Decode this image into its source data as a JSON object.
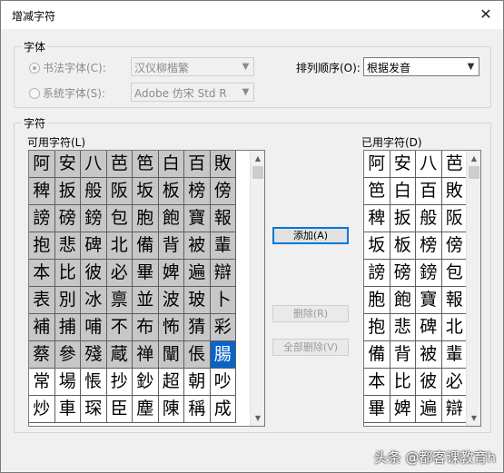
{
  "window": {
    "title": "增减字符",
    "close": "✕"
  },
  "font_group": {
    "label": "字体",
    "calligraphy_radio": "书法字体(C):",
    "calligraphy_value": "汉仪柳楷繁",
    "system_radio": "系统字体(S):",
    "system_value": "Adobe 仿宋 Std R",
    "sort_label": "排列顺序(O):",
    "sort_value": "根据发音"
  },
  "chars_group": {
    "label": "字符",
    "available_label": "可用字符(L)",
    "used_label": "已用字符(D)",
    "available": [
      [
        "阿",
        "安",
        "八",
        "芭",
        "笆",
        "白",
        "百",
        "敗"
      ],
      [
        "稗",
        "扳",
        "般",
        "阪",
        "坂",
        "板",
        "榜",
        "傍"
      ],
      [
        "謗",
        "磅",
        "鎊",
        "包",
        "胞",
        "飽",
        "寶",
        "報"
      ],
      [
        "抱",
        "悲",
        "碑",
        "北",
        "備",
        "背",
        "被",
        "輩"
      ],
      [
        "本",
        "比",
        "彼",
        "必",
        "畢",
        "婢",
        "遍",
        "辯"
      ],
      [
        "表",
        "別",
        "冰",
        "禀",
        "並",
        "波",
        "玻",
        "卜"
      ],
      [
        "補",
        "捕",
        "哺",
        "不",
        "布",
        "怖",
        "猜",
        "彩"
      ],
      [
        "蔡",
        "參",
        "殘",
        "蔵",
        "禅",
        "闡",
        "倀",
        "腸"
      ],
      [
        "常",
        "場",
        "悵",
        "抄",
        "鈔",
        "超",
        "朝",
        "吵"
      ],
      [
        "炒",
        "車",
        "琛",
        "臣",
        "塵",
        "陳",
        "稱",
        "成"
      ]
    ],
    "available_used_rows": 8,
    "selected_char": "腸",
    "used": [
      [
        "阿",
        "安",
        "八",
        "芭"
      ],
      [
        "笆",
        "白",
        "百",
        "敗"
      ],
      [
        "稗",
        "扳",
        "般",
        "阪"
      ],
      [
        "坂",
        "板",
        "榜",
        "傍"
      ],
      [
        "謗",
        "磅",
        "鎊",
        "包"
      ],
      [
        "胞",
        "飽",
        "寶",
        "報"
      ],
      [
        "抱",
        "悲",
        "碑",
        "北"
      ],
      [
        "備",
        "背",
        "被",
        "輩"
      ],
      [
        "本",
        "比",
        "彼",
        "必"
      ],
      [
        "畢",
        "婢",
        "遍",
        "辯"
      ]
    ],
    "add_button": "添加(A)",
    "remove_button": "删除(R)",
    "remove_all_button": "全部删除(V)"
  },
  "watermark": "头条 @都客课教育h"
}
